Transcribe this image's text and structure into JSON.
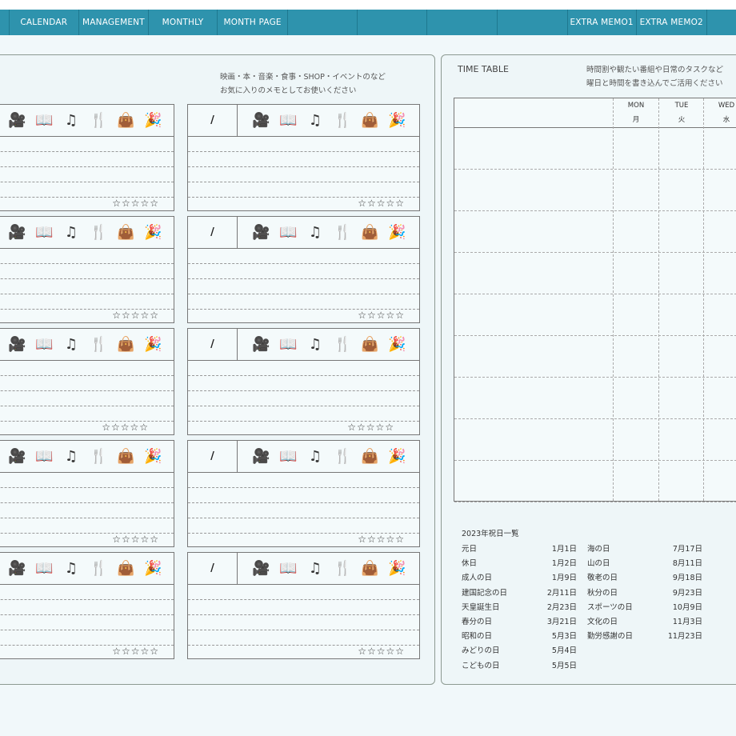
{
  "nav": {
    "tabs": [
      "CALENDAR",
      "MANAGEMENT",
      "MONTHLY",
      "MONTH PAGE",
      "",
      "",
      "",
      "EXTRA MEMO1",
      "EXTRA MEMO2",
      ""
    ]
  },
  "memo": {
    "note_line1": "映画・本・音楽・食事・SHOP・イベントのなど",
    "note_line2": "お気に入りのメモとしてお使いください",
    "date_placeholder": "/",
    "stars": "☆☆☆☆☆",
    "icons": [
      "movie-camera-icon",
      "book-icon",
      "music-note-icon",
      "fork-knife-icon",
      "handbag-icon",
      "party-popper-icon"
    ]
  },
  "timetable": {
    "title": "TIME TABLE",
    "note_line1": "時間割や観たい番組や日常のタスクなど",
    "note_line2": "曜日と時間を書き込んでご活用ください",
    "days_en": [
      "MON",
      "TUE",
      "WED"
    ],
    "days_ja": [
      "月",
      "火",
      "水"
    ]
  },
  "holidays": {
    "title": "2023年祝日一覧",
    "col1": [
      {
        "name": "元日",
        "date": "1月1日"
      },
      {
        "name": "休日",
        "date": "1月2日"
      },
      {
        "name": "成人の日",
        "date": "1月9日"
      },
      {
        "name": "建国記念の日",
        "date": "2月11日"
      },
      {
        "name": "天皇誕生日",
        "date": "2月23日"
      },
      {
        "name": "春分の日",
        "date": "3月21日"
      },
      {
        "name": "昭和の日",
        "date": "5月3日"
      },
      {
        "name": "みどりの日",
        "date": "5月4日"
      },
      {
        "name": "こどもの日",
        "date": "5月5日"
      }
    ],
    "col2": [
      {
        "name": "海の日",
        "date": "7月17日"
      },
      {
        "name": "山の日",
        "date": "8月11日"
      },
      {
        "name": "敬老の日",
        "date": "9月18日"
      },
      {
        "name": "秋分の日",
        "date": "9月23日"
      },
      {
        "name": "スポーツの日",
        "date": "10月9日"
      },
      {
        "name": "文化の日",
        "date": "11月3日"
      },
      {
        "name": "勤労感謝の日",
        "date": "11月23日"
      }
    ]
  }
}
